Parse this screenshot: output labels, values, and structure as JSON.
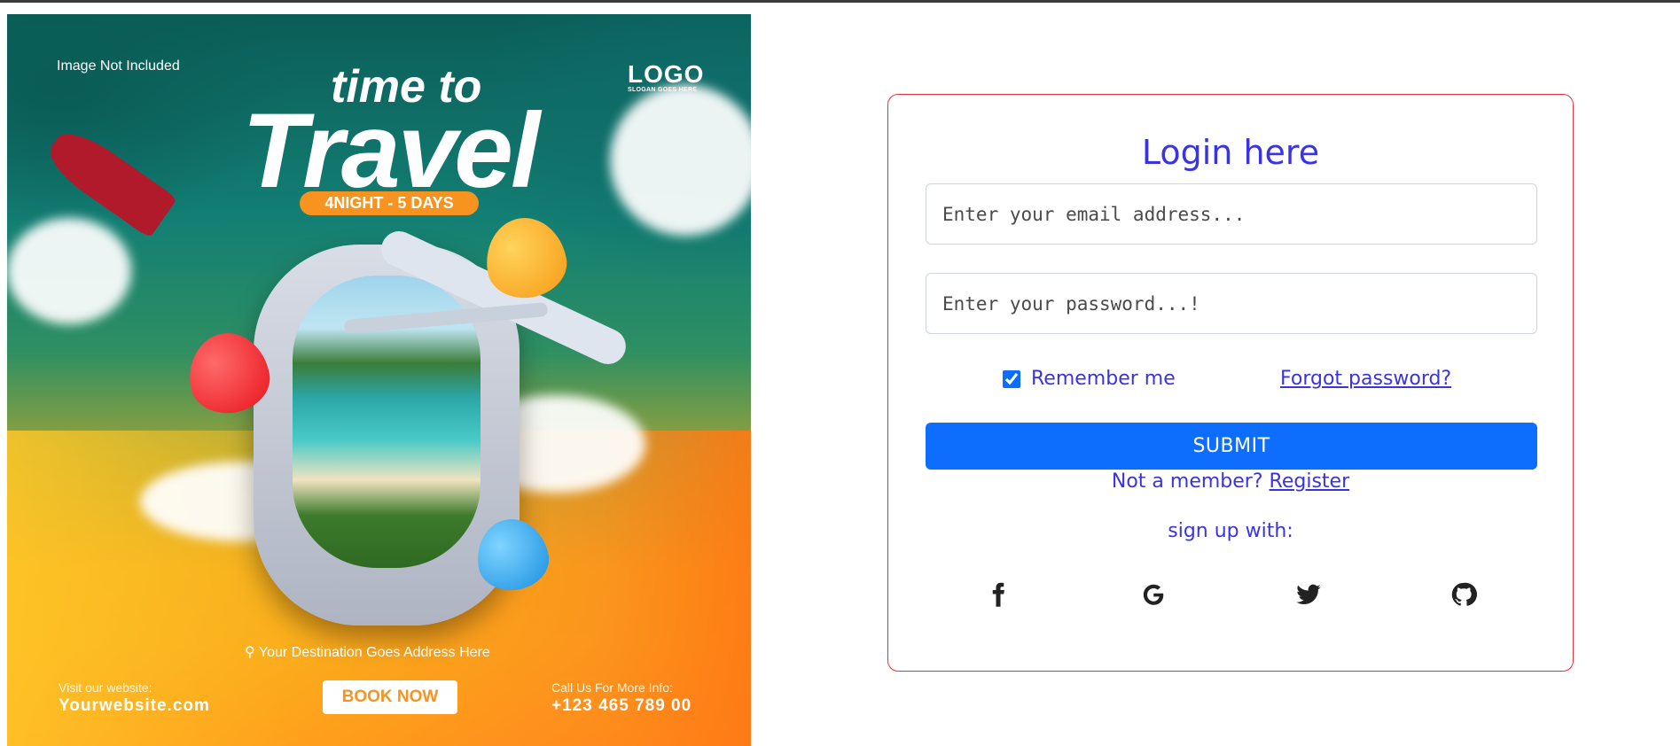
{
  "poster": {
    "image_note": "Image Not Included",
    "logo": "LOGO",
    "logo_slogan": "SLOGAN GOES HERE",
    "title_small": "time to",
    "title_big": "Travel",
    "duration": "4NIGHT - 5 DAYS",
    "destination": "Your Destination Goes Address Here",
    "website_label": "Visit our website:",
    "website": "Yourwebsite.com",
    "book_now": "BOOK NOW",
    "call_label": "Call Us For More Info:",
    "phone": "+123 465 789 00",
    "colors": {
      "teal": "#137f74",
      "orange": "#f7931e"
    }
  },
  "login": {
    "title": "Login here",
    "email_placeholder": "Enter your email address...",
    "password_placeholder": "Enter your password...!",
    "remember_label": "Remember me",
    "remember_checked": true,
    "forgot_label": "Forgot password?",
    "submit_label": "SUBMIT",
    "not_member_text": "Not a member?",
    "register_label": "Register",
    "signup_with": "sign up with:",
    "social": [
      "facebook-icon",
      "google-icon",
      "twitter-icon",
      "github-icon"
    ],
    "colors": {
      "accent": "#3a34e0",
      "button": "#0d6efd",
      "card_border": "#e8303a"
    }
  }
}
